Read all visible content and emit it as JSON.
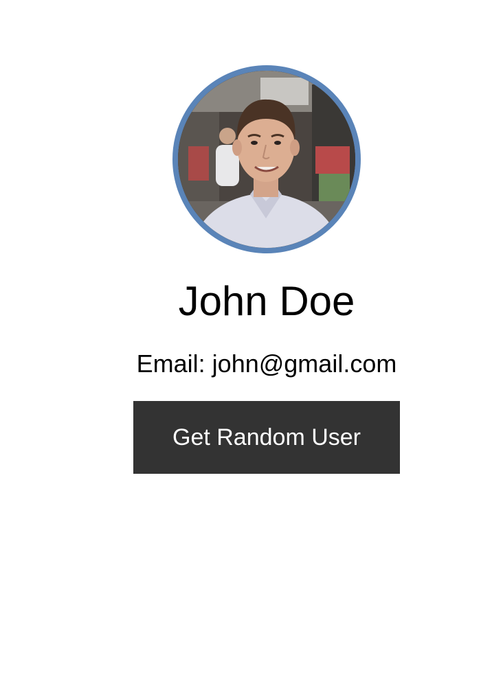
{
  "profile": {
    "name": "John Doe",
    "email_label": "Email: john@gmail.com",
    "avatar_icon": "user-photo",
    "avatar_border_color": "#5a84b8"
  },
  "actions": {
    "random_user_label": "Get Random User",
    "button_color": "#333333"
  }
}
